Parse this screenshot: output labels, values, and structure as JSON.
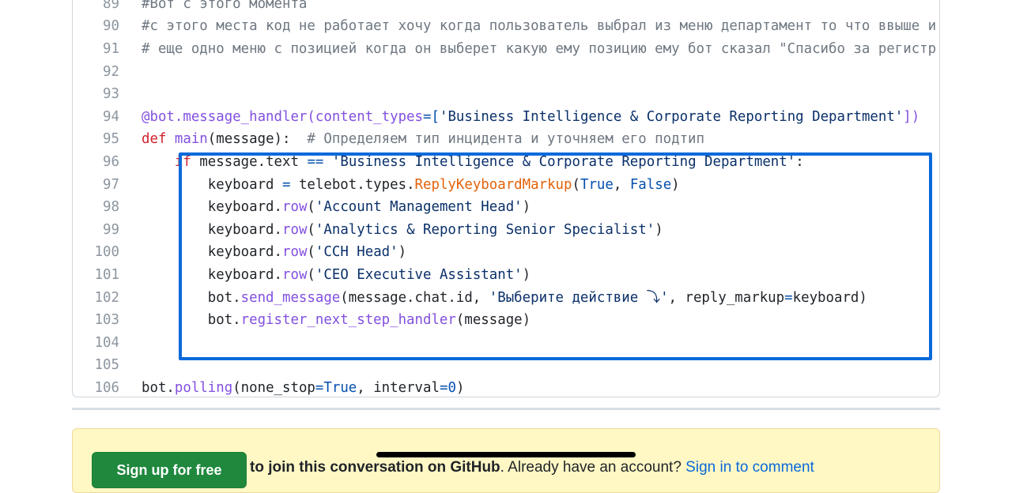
{
  "code_lines": [
    {
      "num": "89",
      "segments": [
        {
          "t": "#Вот с этого момента",
          "c": "cm"
        }
      ]
    },
    {
      "num": "90",
      "segments": [
        {
          "t": "#с этого места код не работает хочу когда пользователь выбрал из меню департамент то что ввыше и",
          "c": "cm"
        }
      ]
    },
    {
      "num": "91",
      "segments": [
        {
          "t": "# еще одно меню с позицией когда он выберет какую ему позицию ему бот сказал \"Спасибо за регистр",
          "c": "cm"
        }
      ]
    },
    {
      "num": "92",
      "segments": []
    },
    {
      "num": "93",
      "segments": []
    },
    {
      "num": "94",
      "segments": [
        {
          "t": "@bot.message_handler",
          "c": "dec"
        },
        {
          "t": "(",
          "c": "dec"
        },
        {
          "t": "content_types",
          "c": "dec"
        },
        {
          "t": "=[",
          "c": "op"
        },
        {
          "t": "'Business Intelligence & Corporate Reporting Department'",
          "c": "str"
        },
        {
          "t": "])",
          "c": "dec"
        }
      ]
    },
    {
      "num": "95",
      "segments": [
        {
          "t": "def ",
          "c": "kw"
        },
        {
          "t": "main",
          "c": "fn"
        },
        {
          "t": "(message):  ",
          "c": ""
        },
        {
          "t": "# Определяем тип инцидента и уточняем его подтип",
          "c": "cm"
        }
      ]
    },
    {
      "num": "96",
      "segments": [
        {
          "t": "    ",
          "c": ""
        },
        {
          "t": "if",
          "c": "kw"
        },
        {
          "t": " message.text ",
          "c": ""
        },
        {
          "t": "==",
          "c": "op"
        },
        {
          "t": " ",
          "c": ""
        },
        {
          "t": "'Business Intelligence & Corporate Reporting Department'",
          "c": "str"
        },
        {
          "t": ":",
          "c": ""
        }
      ]
    },
    {
      "num": "97",
      "segments": [
        {
          "t": "        keyboard ",
          "c": ""
        },
        {
          "t": "=",
          "c": "op"
        },
        {
          "t": " telebot.types.",
          "c": ""
        },
        {
          "t": "ReplyKeyboardMarkup",
          "c": "cls"
        },
        {
          "t": "(",
          "c": ""
        },
        {
          "t": "True",
          "c": "cst"
        },
        {
          "t": ", ",
          "c": ""
        },
        {
          "t": "False",
          "c": "cst"
        },
        {
          "t": ")",
          "c": ""
        }
      ]
    },
    {
      "num": "98",
      "segments": [
        {
          "t": "        keyboard.",
          "c": ""
        },
        {
          "t": "row",
          "c": "fn"
        },
        {
          "t": "(",
          "c": ""
        },
        {
          "t": "'Account Management Head'",
          "c": "str"
        },
        {
          "t": ")",
          "c": ""
        }
      ]
    },
    {
      "num": "99",
      "segments": [
        {
          "t": "        keyboard.",
          "c": ""
        },
        {
          "t": "row",
          "c": "fn"
        },
        {
          "t": "(",
          "c": ""
        },
        {
          "t": "'Analytics & Reporting Senior Specialist'",
          "c": "str"
        },
        {
          "t": ")",
          "c": ""
        }
      ]
    },
    {
      "num": "100",
      "segments": [
        {
          "t": "        keyboard.",
          "c": ""
        },
        {
          "t": "row",
          "c": "fn"
        },
        {
          "t": "(",
          "c": ""
        },
        {
          "t": "'CCH Head'",
          "c": "str"
        },
        {
          "t": ")",
          "c": ""
        }
      ]
    },
    {
      "num": "101",
      "segments": [
        {
          "t": "        keyboard.",
          "c": ""
        },
        {
          "t": "row",
          "c": "fn"
        },
        {
          "t": "(",
          "c": ""
        },
        {
          "t": "'CEO Executive Assistant'",
          "c": "str"
        },
        {
          "t": ")",
          "c": ""
        }
      ]
    },
    {
      "num": "102",
      "segments": [
        {
          "t": "        bot.",
          "c": ""
        },
        {
          "t": "send_message",
          "c": "fn"
        },
        {
          "t": "(message.chat.id, ",
          "c": ""
        },
        {
          "t": "'Выберите действие ⤵'",
          "c": "str"
        },
        {
          "t": ", reply_markup",
          "c": ""
        },
        {
          "t": "=",
          "c": "op"
        },
        {
          "t": "keyboard)",
          "c": ""
        }
      ]
    },
    {
      "num": "103",
      "segments": [
        {
          "t": "        bot.",
          "c": ""
        },
        {
          "t": "register_next_step_handler",
          "c": "fn"
        },
        {
          "t": "(message)",
          "c": ""
        }
      ]
    },
    {
      "num": "104",
      "segments": []
    },
    {
      "num": "105",
      "segments": []
    },
    {
      "num": "106",
      "segments": [
        {
          "t": "bot.",
          "c": ""
        },
        {
          "t": "polling",
          "c": "fn"
        },
        {
          "t": "(none_stop",
          "c": ""
        },
        {
          "t": "=",
          "c": "op"
        },
        {
          "t": "True",
          "c": "cst"
        },
        {
          "t": ", interval",
          "c": ""
        },
        {
          "t": "=",
          "c": "op"
        },
        {
          "t": "0",
          "c": "cst"
        },
        {
          "t": ")",
          "c": ""
        }
      ]
    }
  ],
  "banner": {
    "signup_label": "Sign up for free",
    "bold_text": "to join this conversation on GitHub",
    "plain_text": ". Already have an account? ",
    "signin_link": "Sign in to comment"
  },
  "colors": {
    "highlight_border": "#0969da",
    "banner_bg": "#fff8c5",
    "signup_green": "#1f883d"
  }
}
